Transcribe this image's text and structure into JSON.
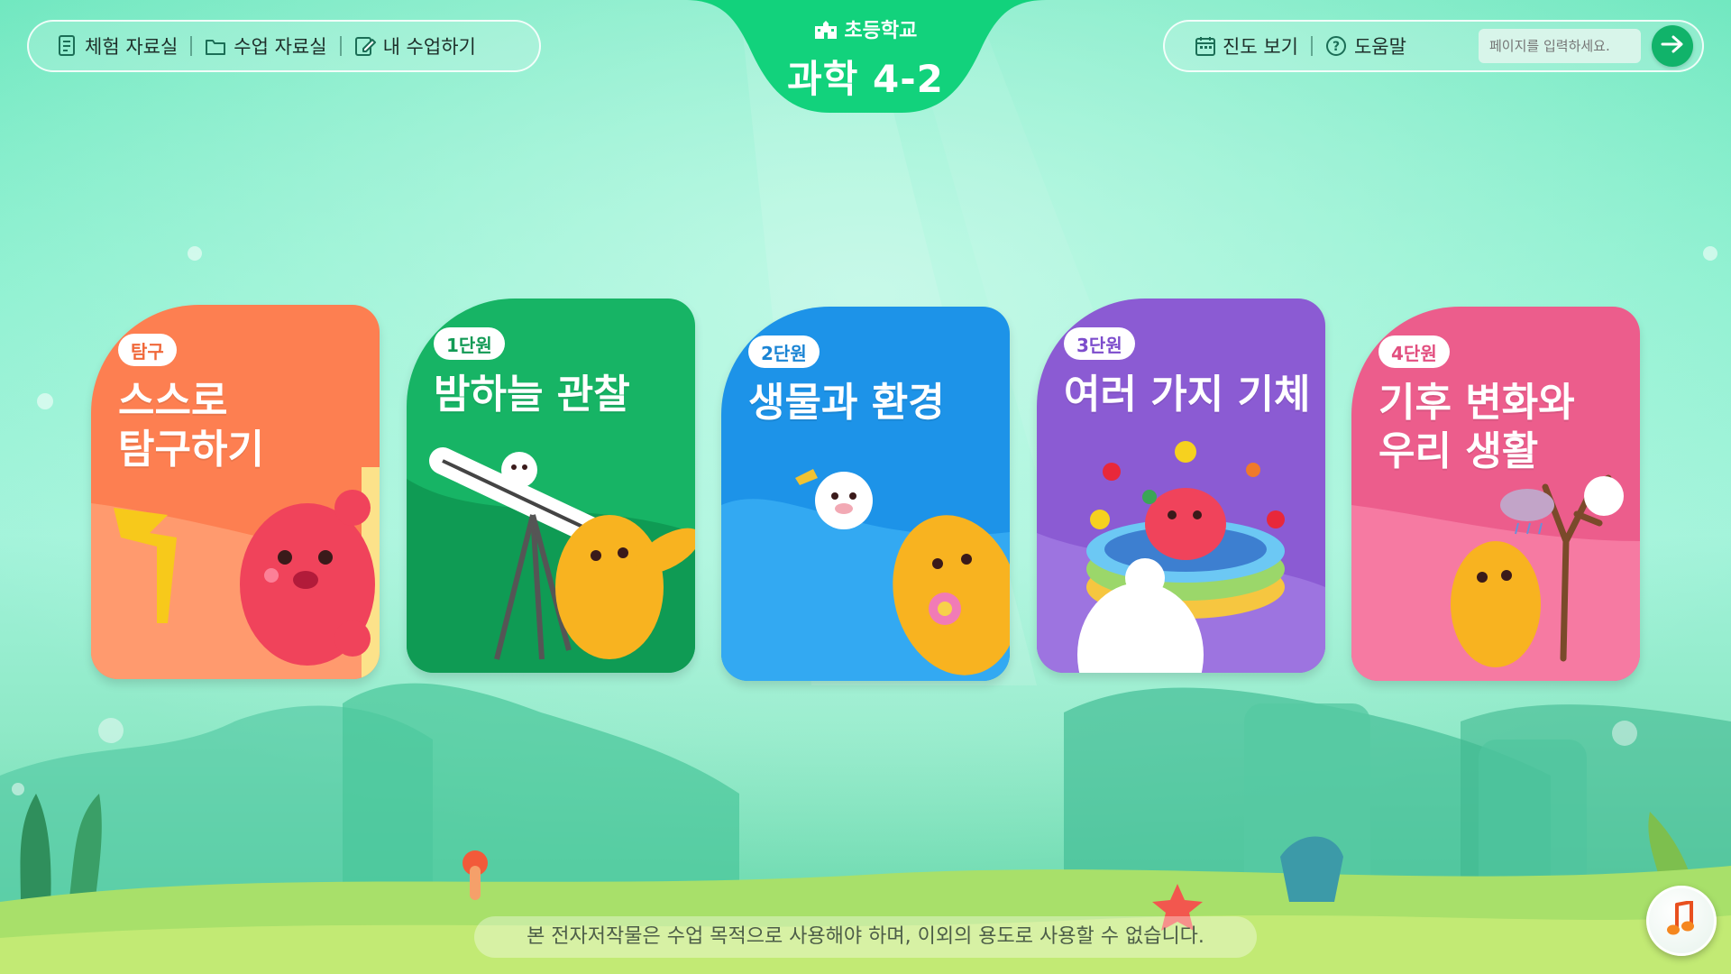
{
  "header": {
    "left_nav": [
      {
        "label": "체험 자료실",
        "icon": "document-list-icon"
      },
      {
        "label": "수업 자료실",
        "icon": "folder-icon"
      },
      {
        "label": "내 수업하기",
        "icon": "edit-note-icon"
      }
    ],
    "school_label": "초등학교",
    "school_icon": "school-building-icon",
    "subject_title": "과학 4-2",
    "right_nav": [
      {
        "label": "진도 보기",
        "icon": "calendar-icon"
      },
      {
        "label": "도움말",
        "icon": "help-circle-icon"
      }
    ],
    "page_input_placeholder": "페이지를 입력하세요.",
    "go_icon": "arrow-right-icon"
  },
  "cards": [
    {
      "badge": "탐구",
      "title": "스스로\n탐구하기",
      "color": "#fd7f51",
      "badge_color": "#f0683a"
    },
    {
      "badge": "1단원",
      "title": "밤하늘 관찰",
      "color": "#17b465",
      "badge_color": "#129a55"
    },
    {
      "badge": "2단원",
      "title": "생물과 환경",
      "color": "#1d93e8",
      "badge_color": "#1a84d4"
    },
    {
      "badge": "3단원",
      "title": "여러 가지 기체",
      "color": "#8b5bd3",
      "badge_color": "#7c4ccc"
    },
    {
      "badge": "4단원",
      "title": "기후 변화와\n우리 생활",
      "color": "#ec5d8c",
      "badge_color": "#e24e7f"
    }
  ],
  "footer": {
    "notice": "본 전자저작물은 수업 목적으로 사용해야 하며, 이외의 용도로 사용할 수 없습니다.",
    "music_icon": "music-note-icon"
  }
}
